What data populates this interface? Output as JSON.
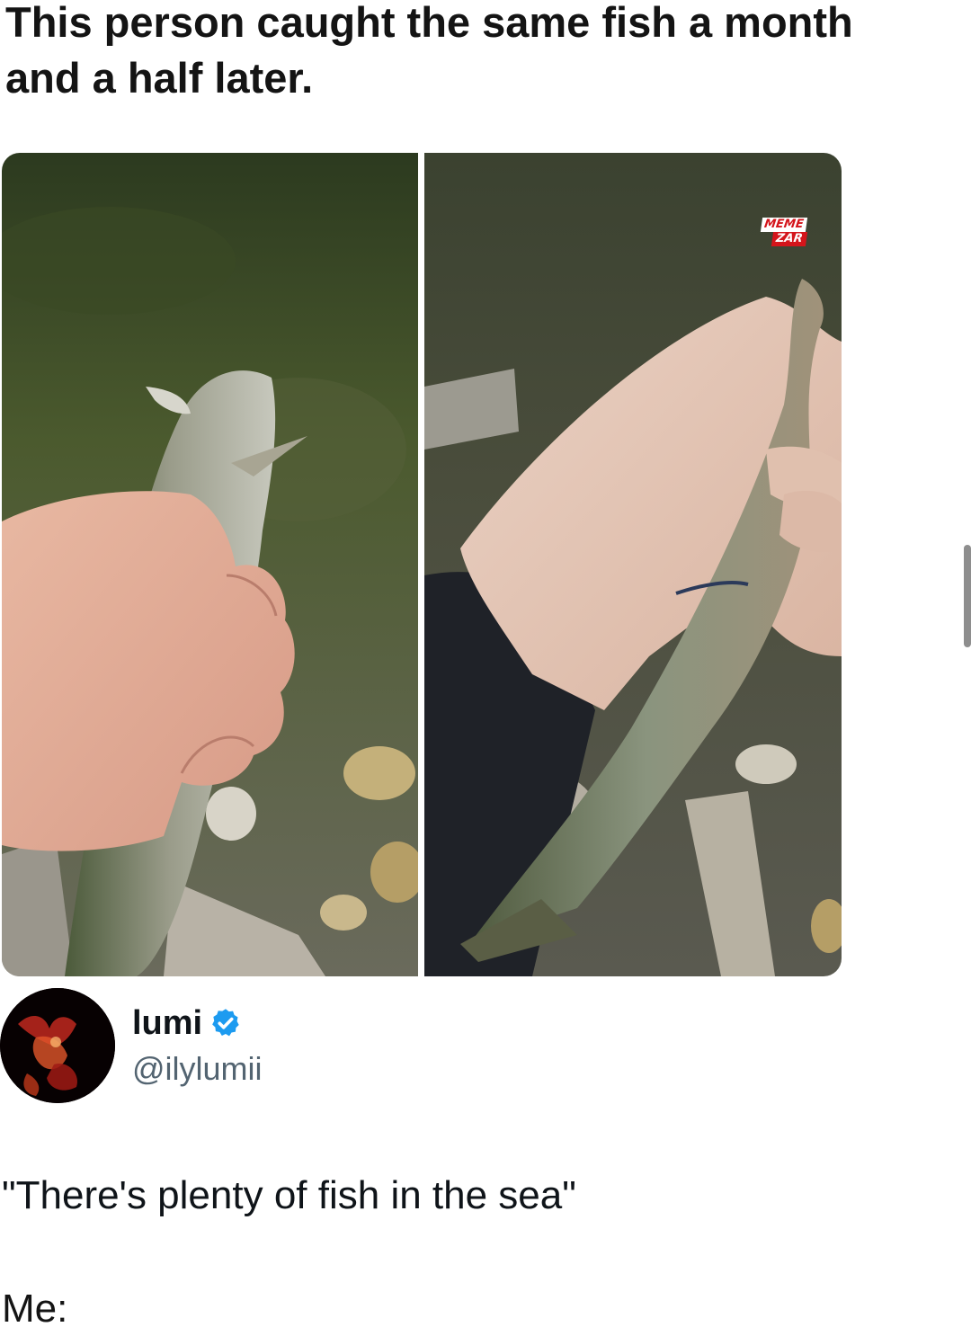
{
  "caption": {
    "line1": "This person caught the same fish a month",
    "line2": "and a half later."
  },
  "photos": [
    {
      "name": "photo-first-catch",
      "icon": "fish-photo"
    },
    {
      "name": "photo-second-catch",
      "icon": "fish-photo"
    }
  ],
  "watermark": {
    "line1": "MEME",
    "line2": "ZAR",
    "colors": {
      "red": "#d4151b",
      "white": "#ffffff"
    }
  },
  "tweet": {
    "author_name": "lumi",
    "author_handle": "@ilylumii",
    "verified": true,
    "verified_icon": "verified-badge-icon",
    "text": "\"There's plenty of fish in the sea\"",
    "colors": {
      "name": "#0f1419",
      "handle": "#536471",
      "badge": "#1d9bf0"
    }
  },
  "footer": {
    "text": "Me:"
  }
}
